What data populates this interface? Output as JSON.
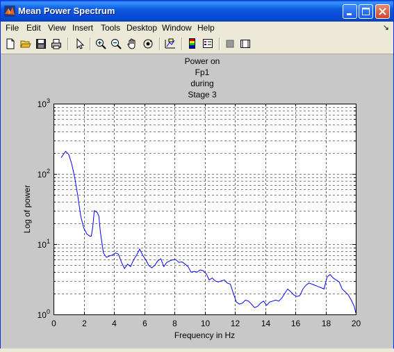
{
  "window": {
    "title": "Mean Power Spectrum"
  },
  "menu": {
    "items": [
      "File",
      "Edit",
      "View",
      "Insert",
      "Tools",
      "Desktop",
      "Window",
      "Help"
    ],
    "arrow": "↘"
  },
  "toolbar": {
    "icons": [
      "new-file-icon",
      "open-folder-icon",
      "save-icon",
      "print-icon",
      "select-arrow-icon",
      "zoom-in-icon",
      "zoom-out-icon",
      "pan-hand-icon",
      "rotate-3d-icon",
      "data-cursor-icon",
      "colorbar-icon",
      "legend-icon",
      "hide-plot-tools-icon",
      "show-plot-tools-icon"
    ]
  },
  "chart_data": {
    "type": "line",
    "title": [
      "Power on",
      "Fp1",
      "during",
      "Stage 3"
    ],
    "xlabel": "Frequency in Hz",
    "ylabel": "Log of power",
    "xlim": [
      0,
      20
    ],
    "ylim": [
      1,
      1000
    ],
    "yscale": "log",
    "grid": true,
    "x_ticks": [
      "0",
      "2",
      "4",
      "6",
      "8",
      "10",
      "12",
      "14",
      "16",
      "18",
      "20"
    ],
    "y_ticks": [
      {
        "base": "10",
        "exp": "0"
      },
      {
        "base": "10",
        "exp": "1"
      },
      {
        "base": "10",
        "exp": "2"
      },
      {
        "base": "10",
        "exp": "3"
      }
    ],
    "line_color": "#0000ff",
    "series": [
      {
        "x": [
          0.5,
          0.8,
          1.0,
          1.2,
          1.4,
          1.6,
          1.8,
          2.0,
          2.2,
          2.4,
          2.5,
          2.6,
          2.7,
          2.9,
          3.0,
          3.1,
          3.3,
          3.5,
          3.7,
          3.9,
          4.1,
          4.3,
          4.5,
          4.7,
          4.9,
          5.1,
          5.3,
          5.5,
          5.7,
          5.9,
          6.1,
          6.3,
          6.5,
          6.7,
          6.9,
          7.1,
          7.3,
          7.5,
          7.7,
          7.9,
          8.1,
          8.3,
          8.5,
          8.7,
          8.9,
          9.1,
          9.3,
          9.5,
          9.7,
          9.9,
          10.1,
          10.3,
          10.5,
          10.7,
          10.9,
          11.1,
          11.3,
          11.5,
          11.7,
          11.9,
          12.1,
          12.3,
          12.5,
          12.7,
          12.9,
          13.1,
          13.3,
          13.5,
          13.7,
          13.9,
          14.1,
          14.3,
          14.5,
          14.7,
          14.9,
          15.1,
          15.3,
          15.5,
          15.7,
          15.9,
          16.1,
          16.3,
          16.5,
          16.7,
          16.9,
          17.1,
          17.3,
          17.5,
          17.7,
          17.9,
          18.1,
          18.3,
          18.5,
          18.7,
          18.9,
          19.1,
          19.3,
          19.5,
          19.7,
          19.9,
          20.0
        ],
        "y": [
          170,
          210,
          190,
          140,
          90,
          50,
          25,
          17,
          14,
          13,
          13,
          18,
          30,
          28,
          25,
          15,
          7.5,
          6.5,
          6.8,
          7.0,
          7.5,
          7.2,
          5.5,
          4.5,
          5.2,
          4.8,
          6.0,
          7.0,
          8.5,
          7.0,
          6.0,
          5.0,
          4.6,
          5.0,
          5.8,
          6.2,
          4.8,
          5.5,
          5.8,
          6.0,
          6.0,
          5.5,
          5.6,
          5.2,
          4.8,
          4.0,
          4.1,
          4.0,
          4.3,
          4.2,
          3.8,
          3.1,
          3.3,
          3.0,
          2.9,
          3.0,
          3.1,
          2.8,
          2.7,
          2.0,
          1.5,
          1.4,
          1.45,
          1.6,
          1.55,
          1.4,
          1.25,
          1.3,
          1.45,
          1.55,
          1.35,
          1.5,
          1.55,
          1.6,
          1.55,
          1.7,
          2.0,
          2.3,
          2.1,
          1.9,
          1.8,
          1.85,
          2.3,
          2.6,
          2.8,
          2.7,
          2.6,
          2.5,
          2.4,
          2.3,
          3.4,
          3.7,
          3.3,
          3.1,
          2.9,
          2.3,
          2.1,
          1.9,
          1.6,
          1.3,
          1.05
        ]
      }
    ]
  }
}
